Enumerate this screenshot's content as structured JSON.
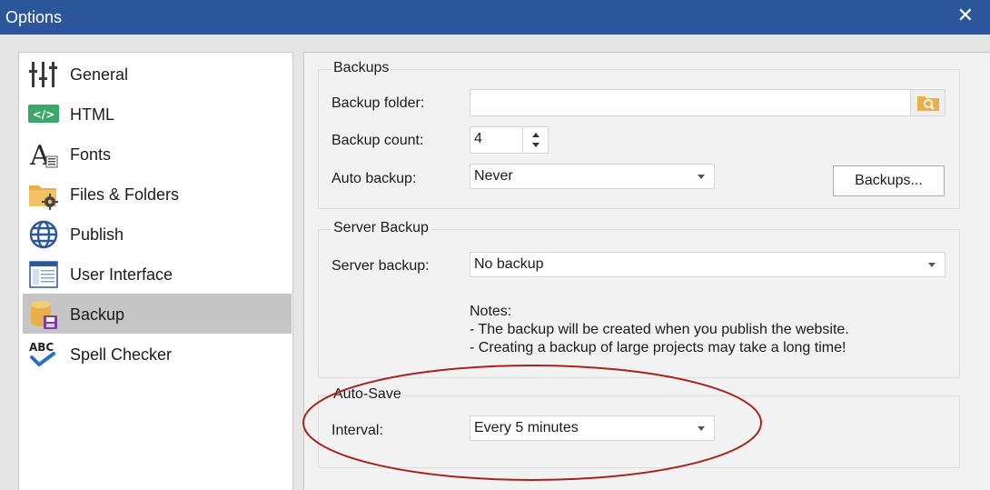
{
  "window": {
    "title": "Options",
    "close_glyph": "✕"
  },
  "sidebar": {
    "items": [
      {
        "label": "General",
        "icon": "sliders-icon"
      },
      {
        "label": "HTML",
        "icon": "html-tag-icon"
      },
      {
        "label": "Fonts",
        "icon": "font-icon"
      },
      {
        "label": "Files & Folders",
        "icon": "folder-gear-icon"
      },
      {
        "label": "Publish",
        "icon": "globe-icon"
      },
      {
        "label": "User Interface",
        "icon": "window-icon"
      },
      {
        "label": "Backup",
        "icon": "database-save-icon",
        "selected": true
      },
      {
        "label": "Spell Checker",
        "icon": "abc-check-icon"
      }
    ]
  },
  "backups": {
    "title": "Backups",
    "folder_label": "Backup folder:",
    "folder_value": "",
    "count_label": "Backup count:",
    "count_value": "4",
    "auto_label": "Auto backup:",
    "auto_value": "Never",
    "backups_button": "Backups..."
  },
  "server_backup": {
    "title": "Server Backup",
    "label": "Server backup:",
    "value": "No backup",
    "notes": [
      "Notes:",
      "- The backup will be created when you publish the website.",
      "- Creating a backup of large projects may take a long time!"
    ]
  },
  "auto_save": {
    "title": "Auto-Save",
    "interval_label": "Interval:",
    "interval_value": "Every 5 minutes"
  },
  "colors": {
    "titlebar": "#2b579a",
    "selection": "#c5c5c5",
    "highlight_ellipse": "#a8231c",
    "folder_button": "#e8b04a"
  }
}
